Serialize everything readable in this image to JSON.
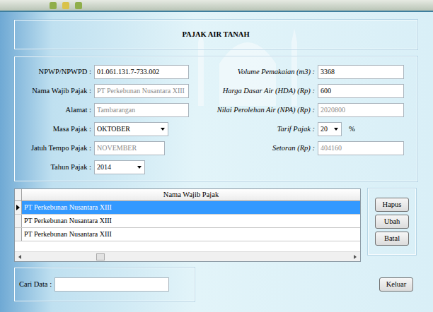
{
  "form": {
    "title": "PAJAK AIR TANAH"
  },
  "left_fields": [
    {
      "label": "NPWP/NPWPD :",
      "value": "01.061.131.7-733.002",
      "kind": "text",
      "disabled": false
    },
    {
      "label": "Nama Wajib Pajak :",
      "value": "PT Perkebunan Nusantara XIII",
      "kind": "text",
      "disabled": true
    },
    {
      "label": "Alamat :",
      "value": "Tambarangan",
      "kind": "text",
      "disabled": true
    },
    {
      "label": "Masa Pajak :",
      "value": "OKTOBER",
      "kind": "combo",
      "disabled": false
    },
    {
      "label": "Jatuh Tempo Pajak :",
      "value": "NOVEMBER",
      "kind": "text",
      "disabled": true
    },
    {
      "label": "Tahun Pajak :",
      "value": "2014",
      "kind": "combo",
      "disabled": false
    }
  ],
  "right_fields": [
    {
      "label": "Volume Pemakaian (m3) :",
      "value": "3368",
      "kind": "text",
      "disabled": false
    },
    {
      "label": "Harga Dasar Air (HDA) (Rp) :",
      "value": "600",
      "kind": "text",
      "disabled": false
    },
    {
      "label": "Nilai Perolehan Air (NPA) (Rp) :",
      "value": "2020800",
      "kind": "text",
      "disabled": true
    },
    {
      "label": "Tarif Pajak :",
      "value": "20",
      "kind": "combo",
      "disabled": false,
      "suffix": "%"
    },
    {
      "label": "Setoran (Rp) :",
      "value": "404160",
      "kind": "text",
      "disabled": true
    }
  ],
  "grid": {
    "column": "Nama Wajib Pajak",
    "rows": [
      {
        "name": "PT Perkebunan Nusantara XIII",
        "selected": true
      },
      {
        "name": "PT Perkebunan Nusantara XIII",
        "selected": false
      },
      {
        "name": "PT Perkebunan Nusantara XIII",
        "selected": false
      }
    ],
    "hscroll": {
      "position": 0.22
    }
  },
  "buttons": [
    "Hapus",
    "Ubah",
    "Batal"
  ],
  "search": {
    "label": "Cari Data :",
    "value": ""
  },
  "exit_button": "Keluar"
}
